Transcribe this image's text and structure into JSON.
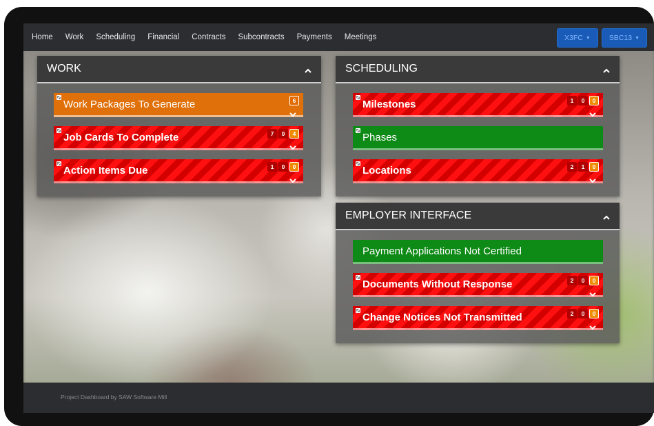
{
  "nav": {
    "links": [
      "Home",
      "Work",
      "Scheduling",
      "Financial",
      "Contracts",
      "Subcontracts",
      "Payments",
      "Meetings"
    ],
    "buttons": [
      "X3FC",
      "SBC13"
    ]
  },
  "work": {
    "title": "WORK",
    "items": [
      {
        "label": "Work Packages To Generate",
        "badges": [
          "6"
        ]
      },
      {
        "label": "Job Cards To Complete",
        "badges": [
          "7",
          "0",
          "4"
        ]
      },
      {
        "label": "Action Items Due",
        "badges": [
          "1",
          "0",
          "0"
        ]
      }
    ]
  },
  "scheduling": {
    "title": "SCHEDULING",
    "items": [
      {
        "label": "Milestones",
        "badges": [
          "1",
          "0",
          "0"
        ]
      },
      {
        "label": "Phases"
      },
      {
        "label": "Locations",
        "badges": [
          "2",
          "1",
          "0"
        ]
      }
    ]
  },
  "employer": {
    "title": "EMPLOYER INTERFACE",
    "items": [
      {
        "label": "Payment Applications Not Certified"
      },
      {
        "label": "Documents Without Response",
        "badges": [
          "2",
          "0",
          "0"
        ]
      },
      {
        "label": "Change Notices Not Transmitted",
        "badges": [
          "2",
          "0",
          "0"
        ]
      }
    ]
  },
  "footer": {
    "text": "Project Dashboard by SAW Software Mill"
  },
  "colors": {
    "red": "#d40000",
    "orange": "#e0700a",
    "green": "#0e8a16",
    "nav": "#2b2d30",
    "accent": "#1a5bb8"
  }
}
